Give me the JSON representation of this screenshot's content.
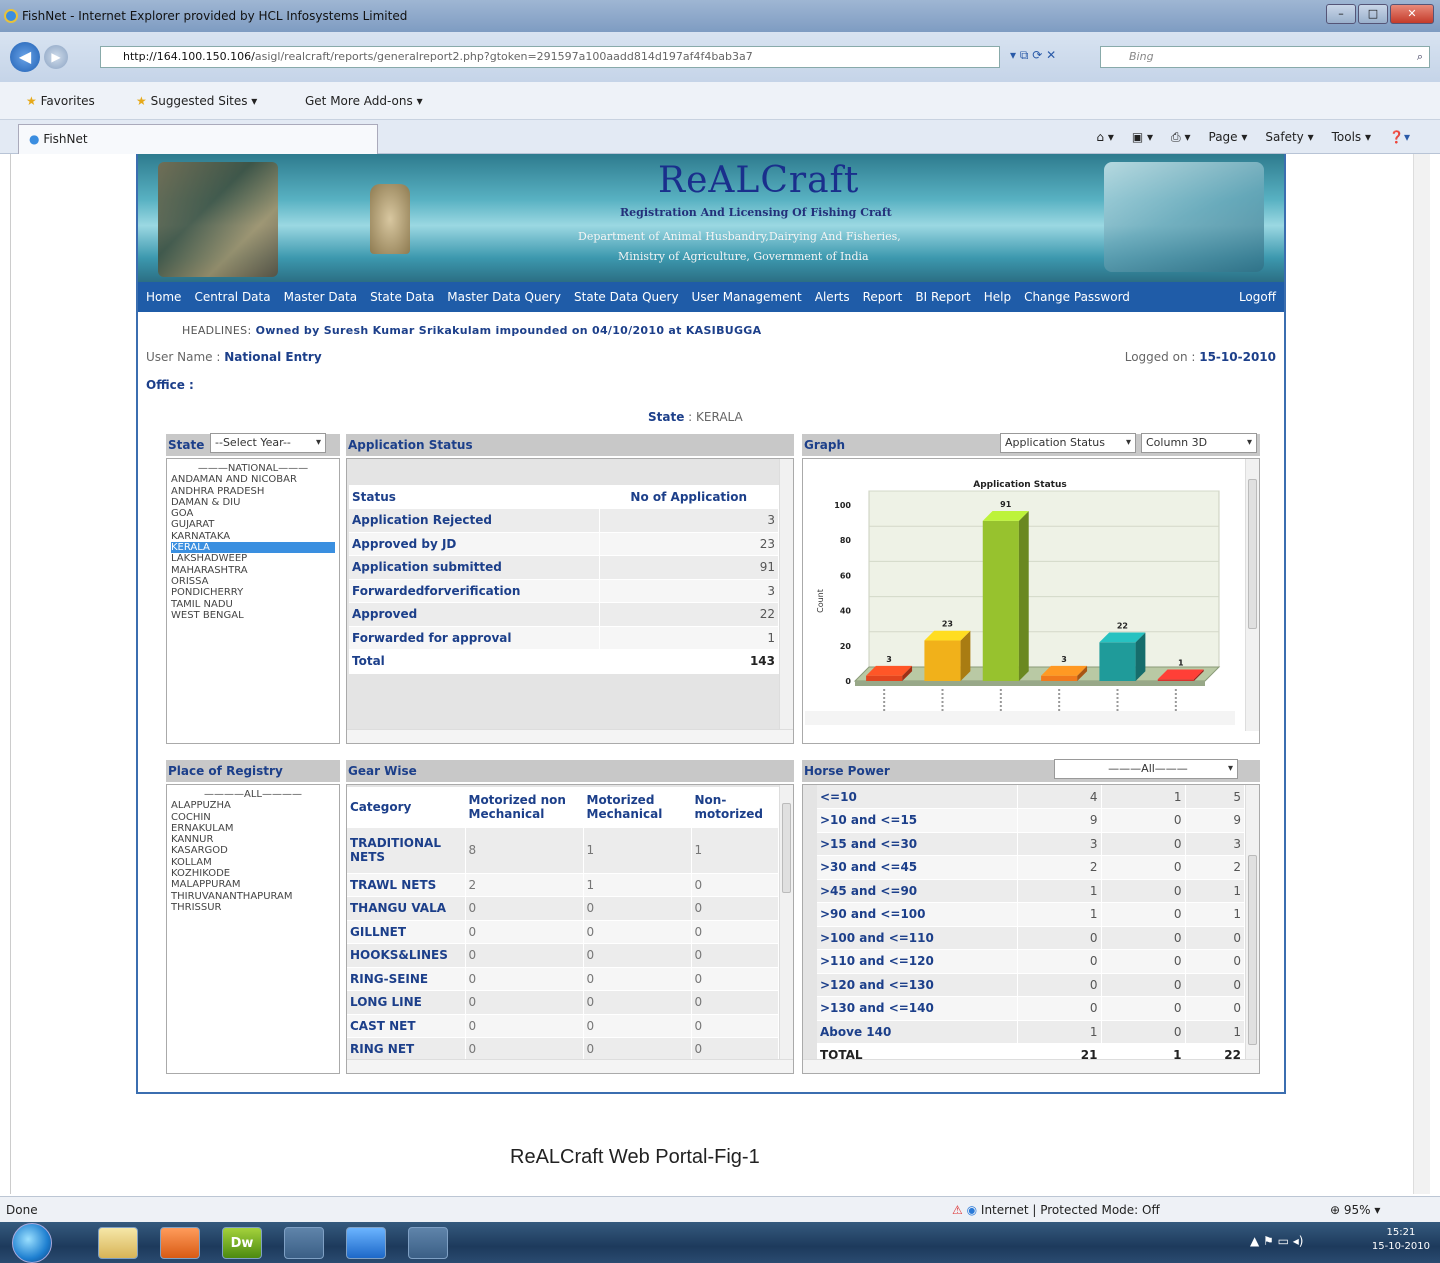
{
  "browser": {
    "title": "FishNet - Internet Explorer provided by HCL Infosystems Limited",
    "url_host": "http://164.100.150.106/",
    "url_path": "asigl/realcraft/reports/generalreport2.php?gtoken=291597a100aadd814d197af4f4bab3a7",
    "search_placeholder": "Bing",
    "favorites_label": "Favorites",
    "fav_items": [
      "Suggested Sites ▾",
      "Get More Add-ons ▾"
    ],
    "tab_label": "FishNet",
    "command_items": [
      "Page ▾",
      "Safety ▾",
      "Tools ▾"
    ],
    "status_left": "Done",
    "status_zone": "Internet | Protected Mode: Off",
    "zoom": "95%",
    "clock_time": "15:21",
    "clock_date": "15-10-2010",
    "taskbar_apps": [
      "",
      "",
      "Dw",
      "",
      "",
      ""
    ]
  },
  "site": {
    "brand": "ReALCraft",
    "brand_sub1": "Registration And Licensing Of Fishing Craft",
    "brand_sub2": "Department of Animal Husbandry,Dairying And Fisheries,",
    "brand_sub3": "Ministry of Agriculture, Government of India",
    "menu": [
      "Home",
      "Central Data",
      "Master Data",
      "State Data",
      "Master Data Query",
      "State Data Query",
      "User Management",
      "Alerts",
      "Report",
      "BI Report",
      "Help",
      "Change Password",
      "Logoff"
    ],
    "headline_label": "HEADLINES:",
    "headline_text": "Owned by Suresh Kumar Srikakulam impounded on 04/10/2010 at KASIBUGGA",
    "user_label": "User Name :",
    "user_value": "National Entry",
    "logged_label": "Logged on :",
    "logged_value": "15-10-2010",
    "office_label": "Office :",
    "state_label": "State",
    "state_value": "KERALA"
  },
  "state_panel": {
    "title": "State",
    "year_select": "--Select Year--",
    "items": [
      "———NATIONAL———",
      "ANDAMAN AND NICOBAR",
      "ANDHRA PRADESH",
      "DAMAN & DIU",
      "GOA",
      "GUJARAT",
      "KARNATAKA",
      "KERALA",
      "LAKSHADWEEP",
      "MAHARASHTRA",
      "ORISSA",
      "PONDICHERRY",
      "TAMIL NADU",
      "WEST BENGAL"
    ],
    "selected": "KERALA"
  },
  "app_status": {
    "title": "Application Status",
    "col1": "Status",
    "col2": "No of Application",
    "rows": [
      {
        "label": "Application Rejected",
        "value": "3"
      },
      {
        "label": "Approved by JD",
        "value": "23"
      },
      {
        "label": "Application submitted",
        "value": "91"
      },
      {
        "label": "Forwardedforverification",
        "value": "3"
      },
      {
        "label": "Approved",
        "value": "22"
      },
      {
        "label": "Forwarded for approval",
        "value": "1"
      },
      {
        "label": "Total",
        "value": "143"
      }
    ]
  },
  "graph_panel": {
    "title": "Graph",
    "select1": "Application Status",
    "select2": "Column 3D"
  },
  "chart_data": {
    "type": "bar",
    "title": "Application Status",
    "ylabel": "Count",
    "xlabel": "",
    "ylim": [
      0,
      100
    ],
    "yticks": [
      0,
      20,
      40,
      60,
      80,
      100
    ],
    "values": [
      3,
      23,
      91,
      3,
      22,
      1
    ],
    "colors": [
      "#e2451f",
      "#f1b11a",
      "#97c22e",
      "#f07a1c",
      "#1f9b9a",
      "#d9322c"
    ],
    "grid": true
  },
  "place_panel": {
    "title": "Place of Registry",
    "items": [
      "————ALL————",
      "ALAPPUZHA",
      "COCHIN",
      "ERNAKULAM",
      "KANNUR",
      "KASARGOD",
      "KOLLAM",
      "KOZHIKODE",
      "MALAPPURAM",
      "THIRUVANANTHAPURAM",
      "THRISSUR"
    ]
  },
  "gear_panel": {
    "title": "Gear Wise",
    "headers": [
      "Category",
      "Motorized non Mechanical",
      "Motorized Mechanical",
      "Non-motorized"
    ],
    "rows": [
      {
        "label": "TRADITIONAL NETS",
        "a": "8",
        "b": "1",
        "c": "1"
      },
      {
        "label": "TRAWL NETS",
        "a": "2",
        "b": "1",
        "c": "0"
      },
      {
        "label": "THANGU VALA",
        "a": "0",
        "b": "0",
        "c": "0"
      },
      {
        "label": "GILLNET",
        "a": "0",
        "b": "0",
        "c": "0"
      },
      {
        "label": "HOOKS&LINES",
        "a": "0",
        "b": "0",
        "c": "0"
      },
      {
        "label": "RING-SEINE",
        "a": "0",
        "b": "0",
        "c": "0"
      },
      {
        "label": "LONG LINE",
        "a": "0",
        "b": "0",
        "c": "0"
      },
      {
        "label": "CAST NET",
        "a": "0",
        "b": "0",
        "c": "0"
      },
      {
        "label": "RING NET",
        "a": "0",
        "b": "0",
        "c": "0"
      }
    ]
  },
  "hp_panel": {
    "title": "Horse Power",
    "select": "———All———",
    "rows": [
      {
        "label": "<=10",
        "a": "4",
        "b": "1",
        "c": "5"
      },
      {
        "label": ">10 and <=15",
        "a": "9",
        "b": "0",
        "c": "9"
      },
      {
        "label": ">15 and <=30",
        "a": "3",
        "b": "0",
        "c": "3"
      },
      {
        "label": ">30 and <=45",
        "a": "2",
        "b": "0",
        "c": "2"
      },
      {
        "label": ">45 and <=90",
        "a": "1",
        "b": "0",
        "c": "1"
      },
      {
        "label": ">90 and <=100",
        "a": "1",
        "b": "0",
        "c": "1"
      },
      {
        "label": ">100 and <=110",
        "a": "0",
        "b": "0",
        "c": "0"
      },
      {
        "label": ">110 and <=120",
        "a": "0",
        "b": "0",
        "c": "0"
      },
      {
        "label": ">120 and <=130",
        "a": "0",
        "b": "0",
        "c": "0"
      },
      {
        "label": ">130 and <=140",
        "a": "0",
        "b": "0",
        "c": "0"
      },
      {
        "label": "Above 140",
        "a": "1",
        "b": "0",
        "c": "1"
      },
      {
        "label": "TOTAL",
        "a": "21",
        "b": "1",
        "c": "22"
      }
    ]
  },
  "caption": "ReALCraft Web Portal-Fig-1"
}
